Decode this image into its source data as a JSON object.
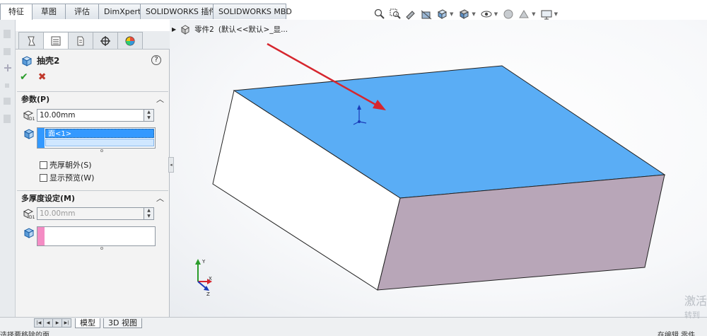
{
  "command_tabs": [
    "特征",
    "草图",
    "评估",
    "DimXpert",
    "SOLIDWORKS 插件",
    "SOLIDWORKS MBD"
  ],
  "tree": {
    "part_label": "零件2",
    "config_label": "(默认<<默认>_显..."
  },
  "property_manager": {
    "feature_name": "抽壳2",
    "help_label": "?",
    "ok_label": "✔",
    "cancel_label": "✖",
    "parameters": {
      "header": "参数(P)",
      "thickness": "10.00mm",
      "faces_to_remove": [
        "面<1>"
      ],
      "shell_outward_label": "壳厚朝外(S)",
      "show_preview_label": "显示预览(W)"
    },
    "multi_thickness": {
      "header": "多厚度设定(M)",
      "thickness": "10.00mm"
    }
  },
  "bottom_tabs": [
    "模型",
    "3D 视图"
  ],
  "status_left": "选择要移除的面",
  "status_right": "在编辑 零件",
  "watermark": [
    "激活",
    "转到"
  ],
  "colors": {
    "selected_face": "#5aadf5",
    "side_face": "#b8a6b8",
    "front_face": "#ffffff",
    "arrow": "#d6262e",
    "selection_blue": "#3399ff",
    "multi_thickness_swatch": "#f48cc4"
  },
  "icons": [
    "zoom-fit-icon",
    "zoom-area-icon",
    "previous-view-icon",
    "section-view-icon",
    "view-orientation-icon",
    "display-style-icon",
    "hide-show-icon",
    "edit-appearance-icon",
    "scene-icon",
    "view-settings-icon"
  ]
}
